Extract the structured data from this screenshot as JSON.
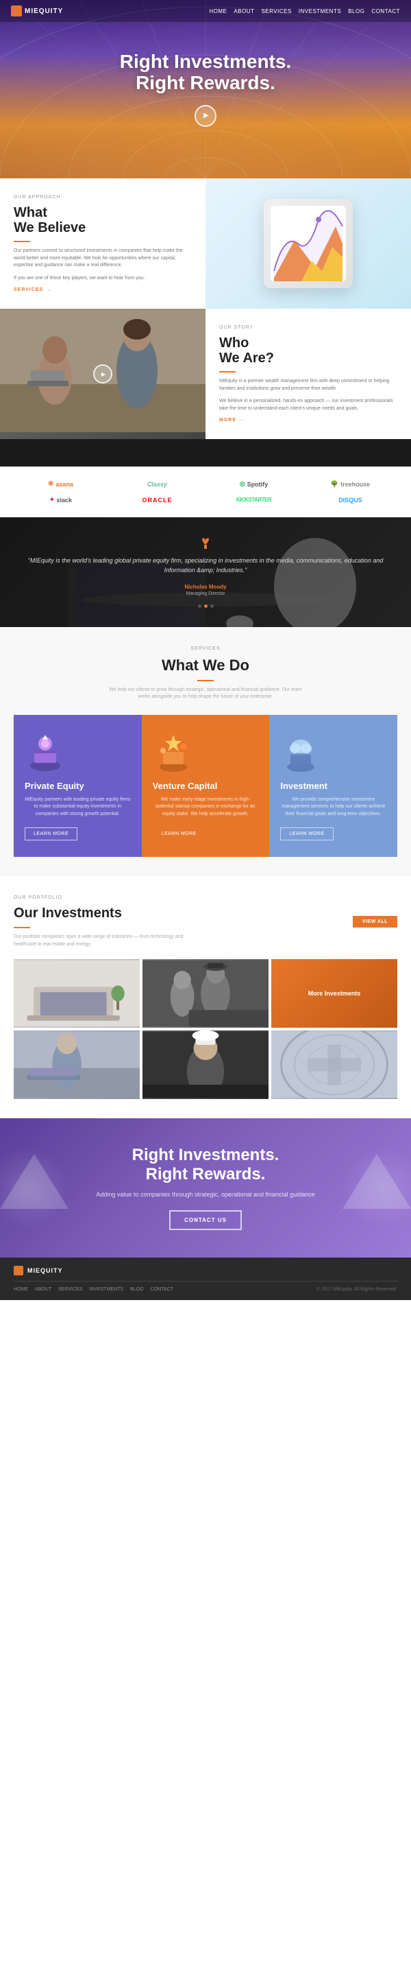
{
  "nav": {
    "logo_text": "MIEQUITY",
    "links": [
      "HOME",
      "ABOUT",
      "SERVICES",
      "INVESTMENTS",
      "BLOG",
      "CONTACT"
    ]
  },
  "hero": {
    "title_line1": "Right Investments.",
    "title_line2": "Right Rewards."
  },
  "believe": {
    "label": "OUR APPROACH",
    "heading_line1": "What",
    "heading_line2": "We Believe",
    "body": "Our partners commit to structured investments in companies that help make the world better and more equitable. We look for opportunities where our capital, expertise and guidance can make a real difference.",
    "body2": "If you are one of those key players, we want to hear from you.",
    "services_link": "SERVICES"
  },
  "who": {
    "label": "OUR STORY",
    "heading_line1": "Who",
    "heading_line2": "We Are?",
    "body1": "MiEquity is a premier wealth management firm with deep commitment to helping families and institutions grow and preserve their wealth.",
    "body2": "We believe in a personalized, hands-on approach — our investment professionals take the time to understand each client's unique needs and goals.",
    "more_link": "MORE"
  },
  "brands": {
    "items": [
      {
        "name": "asana",
        "label": "asana"
      },
      {
        "name": "classy",
        "label": "Classy"
      },
      {
        "name": "spotify",
        "label": "Spotify"
      },
      {
        "name": "treehouse",
        "label": "treehouse"
      },
      {
        "name": "slack",
        "label": "slack"
      },
      {
        "name": "oracle",
        "label": "ORACLE"
      },
      {
        "name": "kickstarter",
        "label": "KICKSTARTER"
      },
      {
        "name": "disqus",
        "label": "DISQUS"
      }
    ]
  },
  "testimonial": {
    "icon": "❧",
    "text": "MIEquity is the world's leading global private equity firm, specializing in investments in the media, communications, education and Information &amp; Industries.",
    "author": "Nicholas Moody",
    "role": "Managing Director",
    "dots": 3,
    "active_dot": 1
  },
  "what_we_do": {
    "label": "SERVICES",
    "heading": "What We Do",
    "description": "We help our clients to grow through strategic, operational and financial guidance. Our team works alongside you to help shape the future of your enterprise.",
    "cards": [
      {
        "title": "Private Equity",
        "description": "MiEquity partners with leading private equity firms to make substantial equity investments in companies with strong growth potential.",
        "btn_label": "LEARN MORE",
        "icon_type": "purple"
      },
      {
        "title": "Venture Capital",
        "description": "We make early-stage investments in high-potential startup companies in exchange for an equity stake. We help accelerate growth.",
        "btn_label": "LEARN MORE",
        "icon_type": "orange"
      },
      {
        "title": "Investment",
        "description": "We provide comprehensive investment management services to help our clients achieve their financial goals and long-term objectives.",
        "btn_label": "LEARN MORE",
        "icon_type": "blue"
      }
    ]
  },
  "investments": {
    "label": "OUR PORTFOLIO",
    "heading": "Our Investments",
    "description": "Our portfolio companies span a wide range of industries — from technology and healthcare to real estate and energy.",
    "view_all": "VIEW ALL",
    "gallery_items": [
      {
        "label": "",
        "type": "laptop"
      },
      {
        "label": "",
        "type": "people"
      },
      {
        "label": "More Investments",
        "type": "text"
      },
      {
        "label": "",
        "type": "person"
      },
      {
        "label": "",
        "type": "chef"
      },
      {
        "label": "",
        "type": "building"
      }
    ]
  },
  "footer_hero": {
    "title_line1": "Right Investments.",
    "title_line2": "Right Rewards.",
    "subtitle": "Adding value to companies through strategic, operational and financial guidance",
    "cta": "CONTACT US"
  },
  "footer": {
    "logo_text": "MIEQUITY",
    "nav_links": [
      "HOME",
      "ABOUT",
      "SERVICES",
      "INVESTMENTS",
      "BLOG",
      "CONTACT"
    ],
    "copyright": "© 2017 MiEquity. All Rights Reserved."
  }
}
